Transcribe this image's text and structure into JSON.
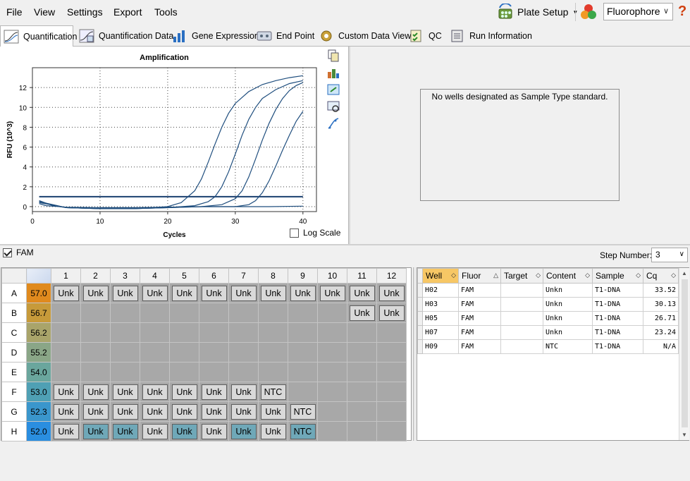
{
  "menu": {
    "file": "File",
    "view": "View",
    "settings": "Settings",
    "export": "Export",
    "tools": "Tools"
  },
  "toolbar": {
    "plate_setup": "Plate Setup",
    "fluorophore": "Fluorophore",
    "help": "?"
  },
  "tabs": [
    {
      "label": "Quantification",
      "active": true
    },
    {
      "label": "Quantification Data"
    },
    {
      "label": "Gene Expression"
    },
    {
      "label": "End Point"
    },
    {
      "label": "Custom Data View"
    },
    {
      "label": "QC"
    },
    {
      "label": "Run Information"
    }
  ],
  "amplification": {
    "log_scale_label": "Log Scale",
    "log_scale_checked": false
  },
  "std_curve": {
    "message": "No wells designated as Sample Type standard."
  },
  "filter": {
    "fam_label": "FAM",
    "fam_checked": true,
    "step_label": "Step Number:",
    "step_value": "3"
  },
  "plate": {
    "columns": [
      "1",
      "2",
      "3",
      "4",
      "5",
      "6",
      "7",
      "8",
      "9",
      "10",
      "11",
      "12"
    ],
    "rows": [
      {
        "label": "A",
        "temp": "57.0",
        "temp_color": "#e08a1e",
        "wells": [
          "Unk",
          "Unk",
          "Unk",
          "Unk",
          "Unk",
          "Unk",
          "Unk",
          "Unk",
          "Unk",
          "Unk",
          "Unk",
          "Unk"
        ],
        "hl": []
      },
      {
        "label": "B",
        "temp": "56.7",
        "temp_color": "#c79a3a",
        "wells": [
          "",
          "",
          "",
          "",
          "",
          "",
          "",
          "",
          "",
          "",
          "Unk",
          "Unk"
        ],
        "hl": []
      },
      {
        "label": "C",
        "temp": "56.2",
        "temp_color": "#a9a46a",
        "wells": [
          "",
          "",
          "",
          "",
          "",
          "",
          "",
          "",
          "",
          "",
          "",
          ""
        ],
        "hl": []
      },
      {
        "label": "D",
        "temp": "55.2",
        "temp_color": "#8aa687",
        "wells": [
          "",
          "",
          "",
          "",
          "",
          "",
          "",
          "",
          "",
          "",
          "",
          ""
        ],
        "hl": []
      },
      {
        "label": "E",
        "temp": "54.0",
        "temp_color": "#6aa69d",
        "wells": [
          "",
          "",
          "",
          "",
          "",
          "",
          "",
          "",
          "",
          "",
          "",
          ""
        ],
        "hl": []
      },
      {
        "label": "F",
        "temp": "53.0",
        "temp_color": "#4fa0b4",
        "wells": [
          "Unk",
          "Unk",
          "Unk",
          "Unk",
          "Unk",
          "Unk",
          "Unk",
          "NTC",
          "",
          "",
          "",
          ""
        ],
        "hl": []
      },
      {
        "label": "G",
        "temp": "52.3",
        "temp_color": "#3a96cc",
        "wells": [
          "Unk",
          "Unk",
          "Unk",
          "Unk",
          "Unk",
          "Unk",
          "Unk",
          "Unk",
          "NTC",
          "",
          "",
          ""
        ],
        "hl": []
      },
      {
        "label": "H",
        "temp": "52.0",
        "temp_color": "#2a8ee0",
        "wells": [
          "Unk",
          "Unk",
          "Unk",
          "Unk",
          "Unk",
          "Unk",
          "Unk",
          "Unk",
          "NTC",
          "",
          "",
          ""
        ],
        "hl": [
          1,
          2,
          4,
          6,
          8
        ]
      }
    ]
  },
  "results": {
    "headers": [
      "Well",
      "Fluor",
      "Target",
      "Content",
      "Sample",
      "Cq"
    ],
    "rows": [
      {
        "well": "H02",
        "fluor": "FAM",
        "target": "",
        "content": "Unkn",
        "sample": "T1-DNA",
        "cq": "33.52"
      },
      {
        "well": "H03",
        "fluor": "FAM",
        "target": "",
        "content": "Unkn",
        "sample": "T1-DNA",
        "cq": "30.13"
      },
      {
        "well": "H05",
        "fluor": "FAM",
        "target": "",
        "content": "Unkn",
        "sample": "T1-DNA",
        "cq": "26.71"
      },
      {
        "well": "H07",
        "fluor": "FAM",
        "target": "",
        "content": "Unkn",
        "sample": "T1-DNA",
        "cq": "23.24"
      },
      {
        "well": "H09",
        "fluor": "FAM",
        "target": "",
        "content": "NTC",
        "sample": "T1-DNA",
        "cq": "N/A"
      }
    ]
  },
  "chart_data": {
    "type": "line",
    "title": "Amplification",
    "xlabel": "Cycles",
    "ylabel": "RFU (10^3)",
    "xlim": [
      0,
      42
    ],
    "ylim": [
      -0.5,
      14
    ],
    "x_ticks": [
      0,
      10,
      20,
      30,
      40
    ],
    "y_ticks": [
      0,
      2,
      4,
      6,
      8,
      10,
      12
    ],
    "grid": true,
    "threshold": 1.0,
    "series": [
      {
        "ct": 23.2,
        "values": [
          [
            1,
            0.6
          ],
          [
            3,
            0.1
          ],
          [
            5,
            -0.1
          ],
          [
            10,
            -0.2
          ],
          [
            15,
            -0.2
          ],
          [
            20,
            0.0
          ],
          [
            22,
            0.4
          ],
          [
            24,
            1.6
          ],
          [
            25,
            2.8
          ],
          [
            26,
            4.5
          ],
          [
            27,
            6.3
          ],
          [
            28,
            8.0
          ],
          [
            29,
            9.4
          ],
          [
            30,
            10.4
          ],
          [
            32,
            11.6
          ],
          [
            34,
            12.3
          ],
          [
            36,
            12.7
          ],
          [
            38,
            13.0
          ],
          [
            40,
            13.2
          ]
        ]
      },
      {
        "ct": 26.7,
        "values": [
          [
            1,
            0.5
          ],
          [
            5,
            -0.1
          ],
          [
            10,
            -0.2
          ],
          [
            15,
            -0.2
          ],
          [
            20,
            -0.1
          ],
          [
            24,
            0.1
          ],
          [
            26,
            0.5
          ],
          [
            27,
            1.0
          ],
          [
            28,
            2.0
          ],
          [
            29,
            3.5
          ],
          [
            30,
            5.3
          ],
          [
            31,
            7.2
          ],
          [
            32,
            8.8
          ],
          [
            33,
            10.0
          ],
          [
            34,
            10.9
          ],
          [
            36,
            11.8
          ],
          [
            38,
            12.4
          ],
          [
            40,
            12.7
          ]
        ]
      },
      {
        "ct": 30.1,
        "values": [
          [
            1,
            0.5
          ],
          [
            5,
            -0.1
          ],
          [
            10,
            -0.2
          ],
          [
            15,
            -0.2
          ],
          [
            20,
            -0.1
          ],
          [
            25,
            0.0
          ],
          [
            28,
            0.2
          ],
          [
            30,
            0.8
          ],
          [
            31,
            1.6
          ],
          [
            32,
            3.0
          ],
          [
            33,
            4.8
          ],
          [
            34,
            6.7
          ],
          [
            35,
            8.4
          ],
          [
            36,
            9.8
          ],
          [
            37,
            10.9
          ],
          [
            38,
            11.7
          ],
          [
            39,
            12.2
          ],
          [
            40,
            12.5
          ]
        ]
      },
      {
        "ct": 33.5,
        "values": [
          [
            1,
            0.4
          ],
          [
            5,
            -0.1
          ],
          [
            10,
            -0.2
          ],
          [
            15,
            -0.2
          ],
          [
            20,
            -0.1
          ],
          [
            25,
            0.0
          ],
          [
            30,
            0.0
          ],
          [
            32,
            0.2
          ],
          [
            33,
            0.6
          ],
          [
            34,
            1.4
          ],
          [
            35,
            2.6
          ],
          [
            36,
            4.1
          ],
          [
            37,
            5.7
          ],
          [
            38,
            7.2
          ],
          [
            39,
            8.6
          ],
          [
            40,
            9.6
          ]
        ]
      },
      {
        "ct": null,
        "values": [
          [
            1,
            0.3
          ],
          [
            2,
            0.1
          ],
          [
            5,
            -0.05
          ],
          [
            10,
            -0.1
          ],
          [
            15,
            -0.1
          ],
          [
            20,
            -0.05
          ],
          [
            25,
            0.0
          ],
          [
            30,
            0.0
          ],
          [
            35,
            0.0
          ],
          [
            40,
            0.05
          ]
        ]
      }
    ]
  }
}
